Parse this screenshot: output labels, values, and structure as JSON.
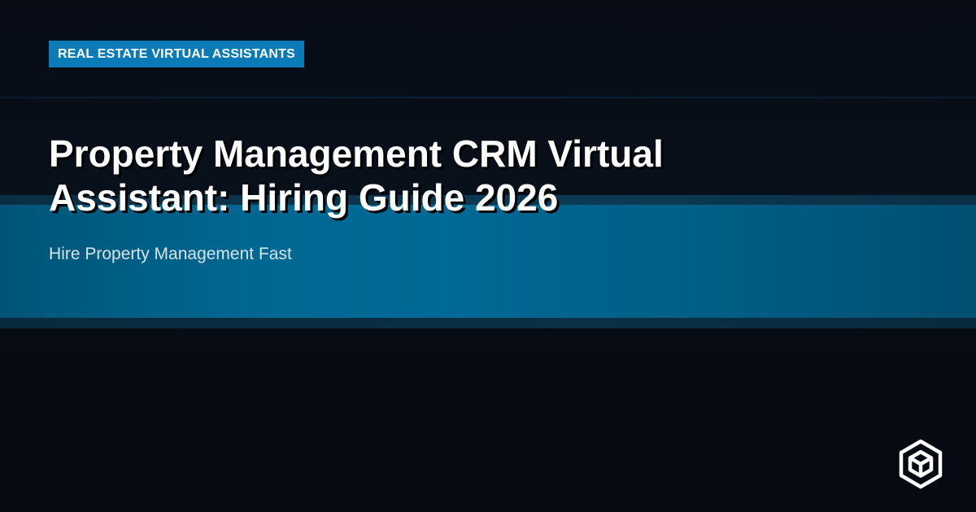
{
  "card": {
    "category": "REAL ESTATE VIRTUAL ASSISTANTS",
    "title": "Property Management CRM Virtual Assistant: Hiring Guide 2026",
    "subtitle": "Hire Property Management Fast"
  },
  "logo": {
    "icon": "isometric-box-logo-icon"
  },
  "colors": {
    "background": "#070c15",
    "band": "#006a96",
    "badge": "#0a7bb7",
    "title_text": "#ffffff",
    "subtitle_text": "#d6e4ee"
  }
}
